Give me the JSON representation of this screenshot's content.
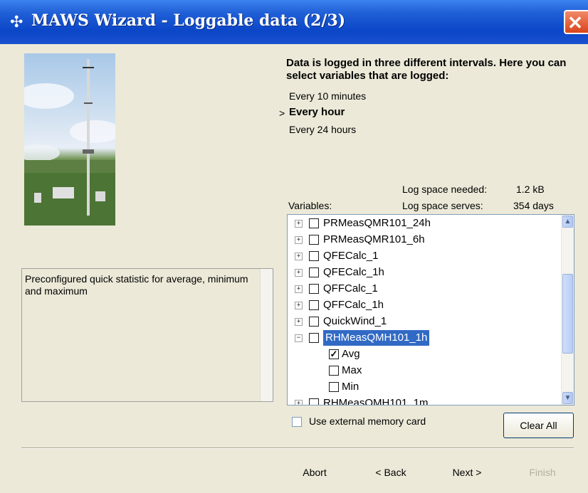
{
  "window": {
    "title": "MAWS Wizard - Loggable data (2/3)",
    "close_glyph": "✕",
    "app_icon": "compass-star-icon"
  },
  "description": {
    "text": "Preconfigured quick statistic for average, minimum and maximum"
  },
  "intervals": {
    "heading": "Data is logged in three different intervals. Here you can select variables that are logged:",
    "items": [
      {
        "label": "Every 10 minutes",
        "selected": false
      },
      {
        "label": "Every hour",
        "selected": true
      },
      {
        "label": "Every 24 hours",
        "selected": false
      }
    ],
    "arrow": ">"
  },
  "log_space": {
    "needed_label": "Log space needed:",
    "needed_value": "1.2 kB",
    "serves_label": "Log space serves:",
    "serves_value": "354 days"
  },
  "variables": {
    "label": "Variables:",
    "items": [
      {
        "name": "PRMeasQMR101_24h",
        "expander": "+",
        "checked": false
      },
      {
        "name": "PRMeasQMR101_6h",
        "expander": "+",
        "checked": false
      },
      {
        "name": "QFECalc_1",
        "expander": "+",
        "checked": false
      },
      {
        "name": "QFECalc_1h",
        "expander": "+",
        "checked": false
      },
      {
        "name": "QFFCalc_1",
        "expander": "+",
        "checked": false
      },
      {
        "name": "QFFCalc_1h",
        "expander": "+",
        "checked": false
      },
      {
        "name": "QuickWind_1",
        "expander": "+",
        "checked": false
      },
      {
        "name": "RHMeasQMH101_1h",
        "expander": "−",
        "checked": false,
        "selected": true
      },
      {
        "name": "Avg",
        "child": true,
        "checked": true
      },
      {
        "name": "Max",
        "child": true,
        "checked": false
      },
      {
        "name": "Min",
        "child": true,
        "checked": false
      },
      {
        "name": "RHMeasQMH101_1m",
        "expander": "+",
        "checked": false,
        "partial": true
      }
    ]
  },
  "options": {
    "external_memory_label": "Use external memory card",
    "external_memory_checked": false,
    "clear_all": "Clear All"
  },
  "buttons": {
    "abort": "Abort",
    "back": "< Back",
    "next": "Next >",
    "finish": "Finish"
  },
  "colors": {
    "title_bar": "#0b46c8",
    "selection": "#316ac5",
    "dialog_bg": "#ece9d8"
  }
}
